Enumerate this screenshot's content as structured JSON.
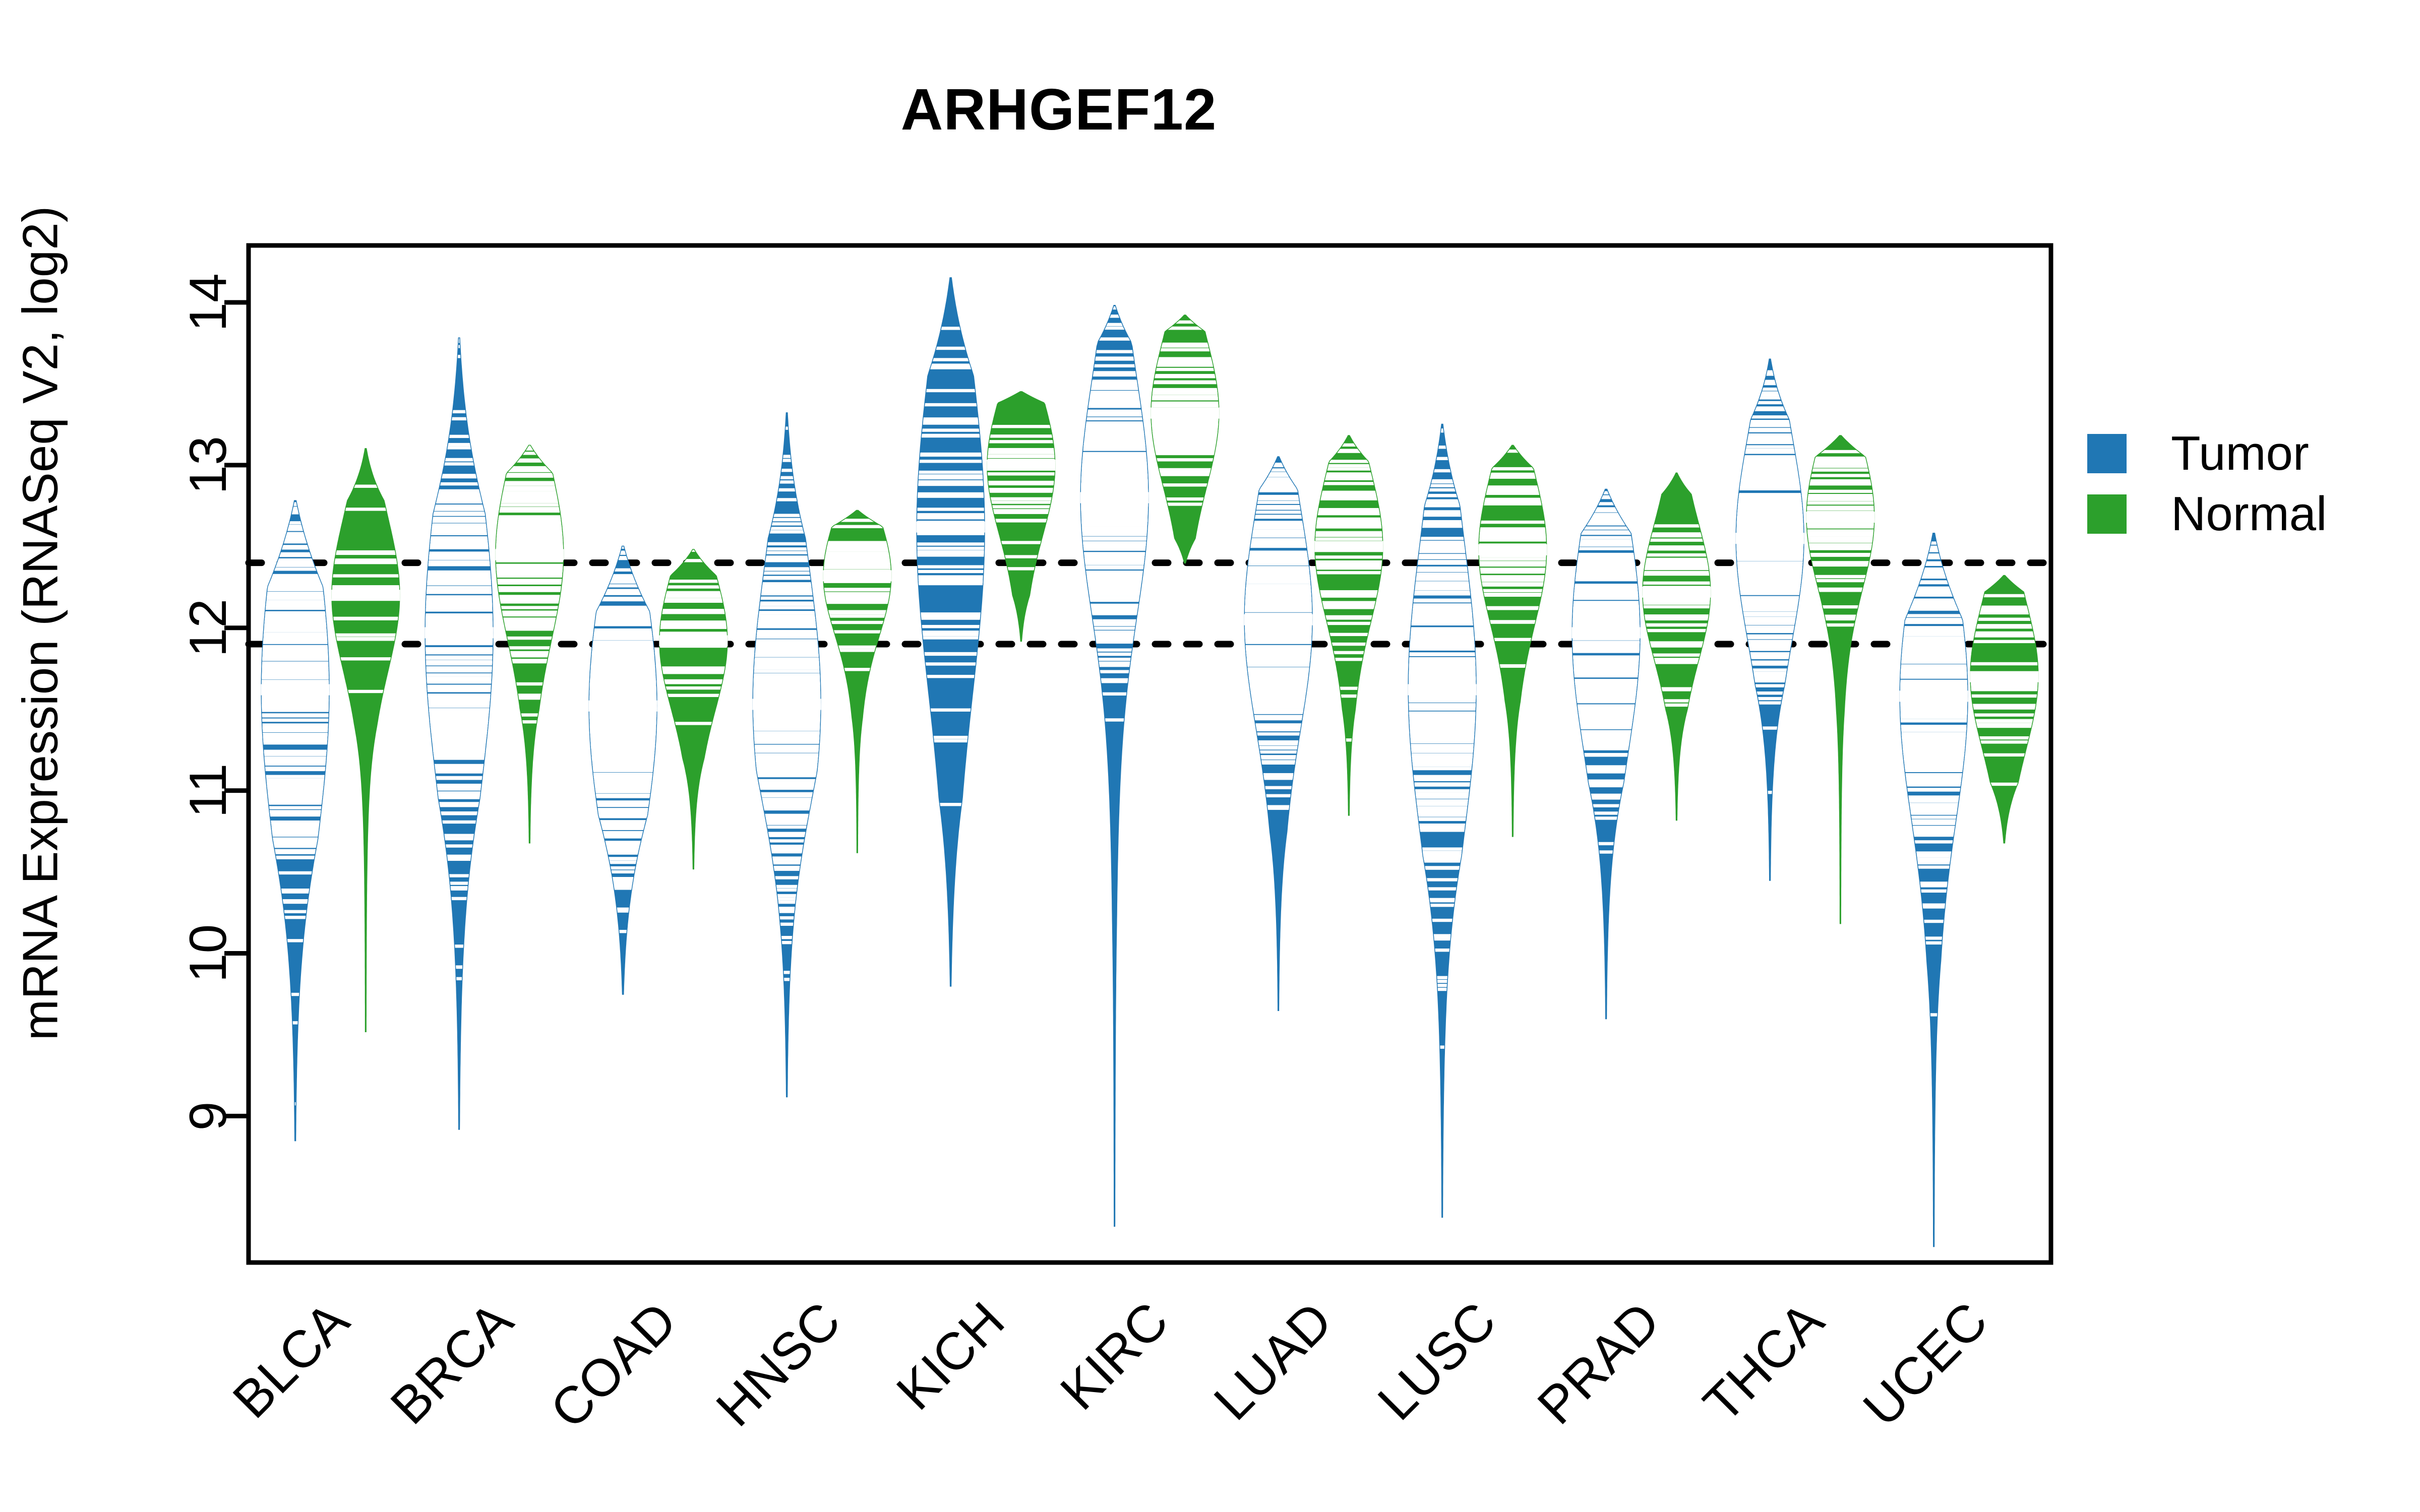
{
  "chart_data": {
    "type": "beanplot",
    "title": "ARHGEF12",
    "xlabel": "",
    "ylabel": "mRNA Expression (RNASeq V2, log2)",
    "ylim": [
      8.1,
      14.35
    ],
    "yticks": [
      9,
      10,
      11,
      12,
      13,
      14
    ],
    "grid": false,
    "legend_position": "right",
    "xtick_rotation": 45,
    "categories": [
      "BLCA",
      "BRCA",
      "COAD",
      "HNSC",
      "KICH",
      "KIRC",
      "LUAD",
      "LUSC",
      "PRAD",
      "THCA",
      "UCEC"
    ],
    "reference_lines": [
      {
        "value": 12.4,
        "style": "dotted",
        "color": "#000000"
      },
      {
        "value": 11.9,
        "style": "dotted",
        "color": "#000000"
      }
    ],
    "series": [
      {
        "name": "Tumor",
        "color": "#2077B4",
        "groups": [
          {
            "category": "BLCA",
            "median": 11.62,
            "q1": 11.15,
            "q3": 12.05,
            "min": 8.85,
            "max": 12.78,
            "density_low": 10.7,
            "density_high": 12.25,
            "n": 408
          },
          {
            "category": "BRCA",
            "median": 11.97,
            "q1": 11.5,
            "q3": 12.4,
            "min": 8.92,
            "max": 13.78,
            "density_low": 10.95,
            "density_high": 12.7,
            "n": 1100
          },
          {
            "category": "COAD",
            "median": 11.52,
            "q1": 11.15,
            "q3": 11.9,
            "min": 9.75,
            "max": 12.5,
            "density_low": 10.85,
            "density_high": 12.1,
            "n": 286
          },
          {
            "category": "HNSC",
            "median": 11.53,
            "q1": 11.2,
            "q3": 12.0,
            "min": 9.12,
            "max": 13.32,
            "density_low": 11.12,
            "density_high": 12.55,
            "n": 522
          },
          {
            "category": "KICH",
            "median": 12.62,
            "q1": 12.05,
            "q3": 13.0,
            "min": 9.8,
            "max": 14.15,
            "density_low": 10.95,
            "density_high": 13.55,
            "n": 66
          },
          {
            "category": "KIRC",
            "median": 12.8,
            "q1": 12.45,
            "q3": 13.15,
            "min": 8.32,
            "max": 13.98,
            "density_low": 10.2,
            "density_high": 13.75,
            "n": 533
          },
          {
            "category": "LUAD",
            "median": 12.05,
            "q1": 11.75,
            "q3": 12.4,
            "min": 9.65,
            "max": 13.05,
            "density_low": 10.75,
            "density_high": 12.85,
            "n": 517
          },
          {
            "category": "LUSC",
            "median": 11.62,
            "q1": 11.25,
            "q3": 12.1,
            "min": 8.38,
            "max": 13.25,
            "density_low": 10.6,
            "density_high": 12.75,
            "n": 501
          },
          {
            "category": "PRAD",
            "median": 11.97,
            "q1": 11.6,
            "q3": 12.3,
            "min": 9.6,
            "max": 12.85,
            "density_low": 11.05,
            "density_high": 12.58,
            "n": 498
          },
          {
            "category": "THCA",
            "median": 12.55,
            "q1": 12.25,
            "q3": 12.85,
            "min": 10.45,
            "max": 13.65,
            "density_low": 11.65,
            "density_high": 13.28,
            "n": 513
          },
          {
            "category": "UCEC",
            "median": 11.58,
            "q1": 11.22,
            "q3": 11.95,
            "min": 8.2,
            "max": 12.58,
            "density_low": 9.95,
            "density_high": 12.05,
            "n": 546
          }
        ]
      },
      {
        "name": "Normal",
        "color": "#2CA02C",
        "groups": [
          {
            "category": "BLCA",
            "median": 12.2,
            "q1": 12.0,
            "q3": 12.45,
            "min": 9.52,
            "max": 13.1,
            "density_low": 11.4,
            "density_high": 12.78,
            "n": 19
          },
          {
            "category": "BRCA",
            "median": 12.45,
            "q1": 12.22,
            "q3": 12.72,
            "min": 10.68,
            "max": 13.12,
            "density_low": 11.5,
            "density_high": 12.95,
            "n": 112
          },
          {
            "category": "COAD",
            "median": 11.92,
            "q1": 11.72,
            "q3": 12.12,
            "min": 10.52,
            "max": 12.48,
            "density_low": 11.2,
            "density_high": 12.32,
            "n": 41
          },
          {
            "category": "HNSC",
            "median": 12.32,
            "q1": 12.15,
            "q3": 12.5,
            "min": 10.62,
            "max": 12.72,
            "density_low": 11.45,
            "density_high": 12.62,
            "n": 44
          },
          {
            "category": "KICH",
            "median": 13.0,
            "q1": 12.78,
            "q3": 13.18,
            "min": 11.92,
            "max": 13.45,
            "density_low": 12.2,
            "density_high": 13.38,
            "n": 25
          },
          {
            "category": "KIRC",
            "median": 13.32,
            "q1": 13.12,
            "q3": 13.55,
            "min": 12.4,
            "max": 13.92,
            "density_low": 12.55,
            "density_high": 13.82,
            "n": 72
          },
          {
            "category": "LUAD",
            "median": 12.5,
            "q1": 12.28,
            "q3": 12.72,
            "min": 10.85,
            "max": 13.18,
            "density_low": 11.5,
            "density_high": 13.02,
            "n": 59
          },
          {
            "category": "LUSC",
            "median": 12.48,
            "q1": 12.28,
            "q3": 12.72,
            "min": 10.72,
            "max": 13.12,
            "density_low": 11.55,
            "density_high": 12.98,
            "n": 51
          },
          {
            "category": "PRAD",
            "median": 12.22,
            "q1": 12.02,
            "q3": 12.42,
            "min": 10.82,
            "max": 12.95,
            "density_low": 11.5,
            "density_high": 12.82,
            "n": 52
          },
          {
            "category": "THCA",
            "median": 12.68,
            "q1": 12.48,
            "q3": 12.9,
            "min": 10.18,
            "max": 13.18,
            "density_low": 11.48,
            "density_high": 13.05,
            "n": 59
          },
          {
            "category": "UCEC",
            "median": 11.7,
            "q1": 11.52,
            "q3": 11.95,
            "min": 10.68,
            "max": 12.32,
            "density_low": 11.05,
            "density_high": 12.22,
            "n": 35
          }
        ]
      }
    ]
  }
}
